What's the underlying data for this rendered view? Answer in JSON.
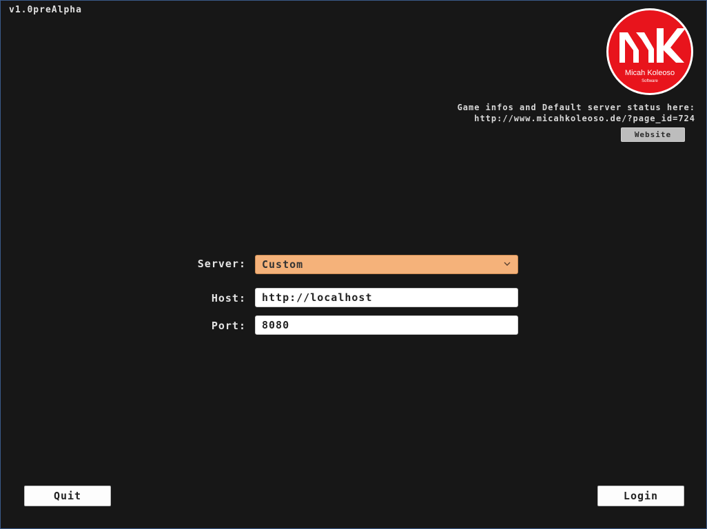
{
  "app": {
    "version": "v1.0preAlpha"
  },
  "logo": {
    "name": "Micah Koleoso",
    "subtitle": "Software",
    "colors": {
      "background": "#e8141c",
      "ring": "#ffffff",
      "text": "#ffffff"
    }
  },
  "info": {
    "line1": "Game infos and Default server status here:",
    "line2": "http://www.micahkoleoso.de/?page_id=724",
    "website_button": "Website"
  },
  "form": {
    "server_label": "Server:",
    "server_value": "Custom",
    "host_label": "Host:",
    "host_value": "http://localhost",
    "port_label": "Port:",
    "port_value": "8080"
  },
  "buttons": {
    "quit": "Quit",
    "login": "Login"
  },
  "colors": {
    "background": "#171717",
    "server_select": "#f5b27a",
    "website_button": "#bdbdbd"
  }
}
